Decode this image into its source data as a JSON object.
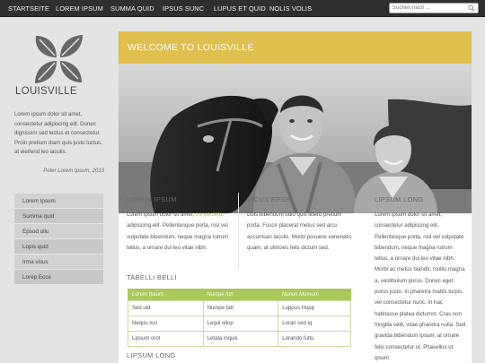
{
  "nav": {
    "items": [
      {
        "label": "STARTSEITE"
      },
      {
        "label": "LOREM IPSUM"
      },
      {
        "label": "SUMMA QUID"
      },
      {
        "label": "IPSUS SUNC"
      },
      {
        "label": "LUPUS ET QUID"
      },
      {
        "label": "NOLIS VOLIS"
      }
    ],
    "search_placeholder": "Suchen nach ..."
  },
  "brand": {
    "name": "LOUISVILLE",
    "logo": "four-leaf-logo"
  },
  "intro": {
    "text": "Lorem ipsum dolor sit amet, consectetur adipiscing elit. Donec dignissim sed lectus et consectetur. Proin pretium diam quis justo luctus, at eleifend leo iaculis.",
    "signature": "Peter Lorem Ipsum, 2013"
  },
  "side_menu": [
    {
      "label": "Lorem Ipsum"
    },
    {
      "label": "Summa quid"
    },
    {
      "label": "Epsod ullu"
    },
    {
      "label": "Lopis quid"
    },
    {
      "label": "Irma visus"
    },
    {
      "label": "Lorep Ecce"
    }
  ],
  "welcome": {
    "title": "WELCOME TO LOUISVILLE"
  },
  "hero": {
    "description": "Vintage black-and-white photograph of a smiling couple standing beside a horse"
  },
  "col1": {
    "title": "LOREM IPSUM",
    "text_before": "Lorem ipsum dolor sit amet, ",
    "link": "consectetur",
    "text_after": " adipiscing elit. Pellentesque porta, nisl vel vulputate bibendum, neque magna rutrum tellus, a ornare dui leo vitae nibh."
  },
  "col2": {
    "title": "VICUS EPSE",
    "text": "Duis bibendum odio quis libero pretium porta. Fusce placerat metus sed arcu accumsan iaculis. Morbi posuere venenatis quam, at ultricies felis dictum sed."
  },
  "col3": {
    "title": "LIPSUM LONG",
    "text": "Lorem ipsum dolor sit amet, consectetur adipiscing elit. Pellentesque porta, nisl vel vulputate bibendum, neque magna rutrum tellus, a ornare dui leo vitae nibh. Morbi ac metus blandit, mollis magna a, vestibulum purus. Donec eget purus justo. In pharetra mattis turpis, vel consectetur nunc. In hac habitasse platea dictumst. Cras non fringilla velit, vitae pharetra nulla. Sed gravida bibendum ipsum, at ornare felis consectetur ut. Phasellus ut ipsum"
  },
  "table": {
    "title": "TABELLI BELLI",
    "headers": [
      "Lorem Ipsum",
      "Numpe futt",
      "Nunon Mumum"
    ],
    "rows": [
      [
        "Sed uid",
        "Numpe fatt",
        "Luppus Hupp"
      ],
      [
        "Nequu issi",
        "Lequi ollop",
        "Loran sed iq"
      ],
      [
        "Lipsum orot",
        "Letata inquis",
        "Lorando futtu"
      ]
    ]
  },
  "bottom": {
    "title": "LIPSUM LONG"
  },
  "colors": {
    "accent": "#dfbf4e",
    "green": "#a8c85a",
    "topbar": "#2f2f2f"
  }
}
